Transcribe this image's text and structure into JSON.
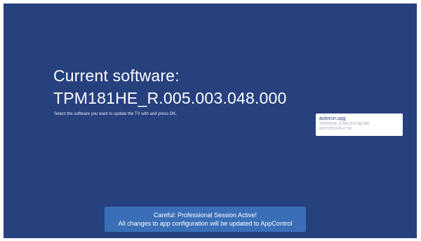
{
  "colors": {
    "background": "#27407e",
    "banner": "#3a6fb8",
    "card": "#ffffff",
    "card_meta": "#9aa4b8"
  },
  "header": {
    "title": "Current software:",
    "version": "TPM181HE_R.005.003.048.000"
  },
  "instruction": "Select the software you want to update the TV with and press OK.",
  "files": [
    {
      "name": "autorun.upg",
      "version": "TPM181HE_R.005.003.048.000",
      "date": "02/07/2019 05:47:59"
    }
  ],
  "banner": {
    "line1": "Careful: Professional Session Active!",
    "line2": "All changes to app configuration will be updated to AppControl"
  }
}
